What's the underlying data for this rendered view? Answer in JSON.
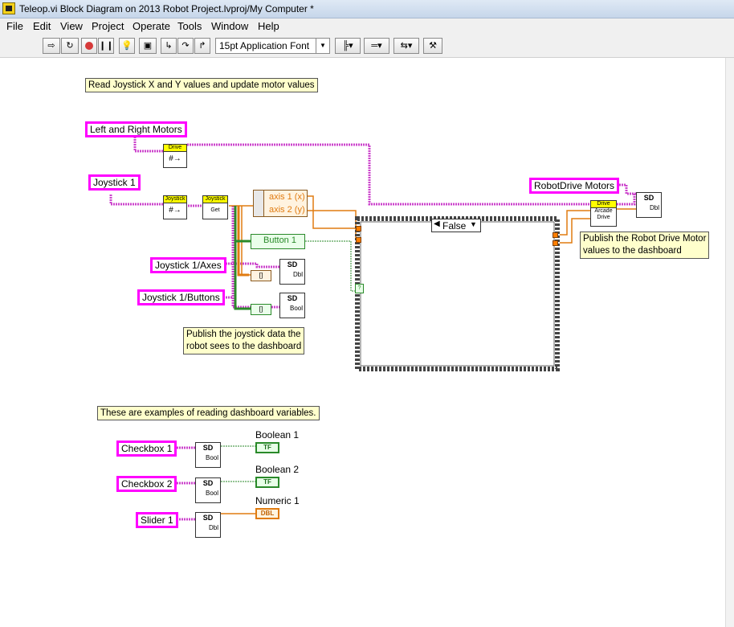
{
  "window": {
    "title": "Teleop.vi Block Diagram on 2013 Robot Project.lvproj/My Computer *"
  },
  "menu": [
    "File",
    "Edit",
    "View",
    "Project",
    "Operate",
    "Tools",
    "Window",
    "Help"
  ],
  "toolbar": {
    "font": "15pt Application Font"
  },
  "diagram": {
    "comments": {
      "read_joystick": "Read Joystick X and Y values and update motor values",
      "publish_motor_1": "Publish the Robot Drive Motor",
      "publish_motor_2": "values to the dashboard",
      "publish_joystick_1": "Publish the joystick data the",
      "publish_joystick_2": "robot sees to the dashboard",
      "examples": "These are examples of reading dashboard variables."
    },
    "labels": {
      "left_right_motors": "Left and Right Motors",
      "joystick1": "Joystick 1",
      "robotdrive_motors": "RobotDrive Motors",
      "joystick_axes": "Joystick 1/Axes",
      "joystick_buttons": "Joystick 1/Buttons",
      "checkbox1": "Checkbox 1",
      "checkbox2": "Checkbox 2",
      "slider1": "Slider 1"
    },
    "vis": {
      "drive": "Drive",
      "joystick": "Joystick",
      "get": "Get",
      "arcade": "Arcade",
      "arcade_drive": "Drive",
      "sd": "SD",
      "dbl": "Dbl",
      "bool": "Bool"
    },
    "unbundle": {
      "axis1": "axis 1 (x)",
      "axis2": "axis 2 (y)",
      "button1": "Button 1"
    },
    "case_selector": "False",
    "indicators": {
      "boolean1": "Boolean 1",
      "boolean2": "Boolean 2",
      "numeric1": "Numeric 1"
    },
    "terminals": {
      "tf": "TF",
      "dbl": "DBL"
    },
    "colors": {
      "comment_bg": "#ffffcc",
      "label_border": "#ff00ff",
      "numeric_wire": "#e07b10",
      "boolean_wire": "#2a8a2a",
      "refnum_wire": "#cc44cc"
    }
  }
}
